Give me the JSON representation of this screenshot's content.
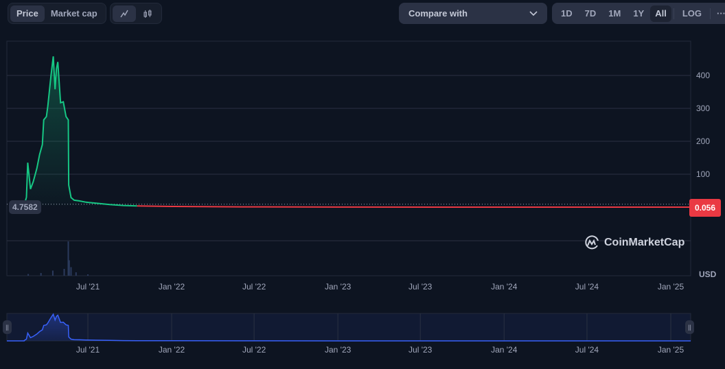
{
  "toolbar": {
    "metric_tabs": [
      {
        "label": "Price",
        "active": true
      },
      {
        "label": "Market cap",
        "active": false
      }
    ],
    "chart_types": [
      {
        "icon": "line-chart-icon",
        "active": true
      },
      {
        "icon": "candlestick-icon",
        "active": false
      }
    ],
    "compare_label": "Compare with",
    "ranges": [
      {
        "label": "1D"
      },
      {
        "label": "7D"
      },
      {
        "label": "1M"
      },
      {
        "label": "1Y"
      },
      {
        "label": "All",
        "active": true
      }
    ],
    "log_label": "LOG",
    "more_label": "···"
  },
  "current_label": "4.7582",
  "last_price_label": "0.056",
  "currency": "USD",
  "watermark": "CoinMarketCap",
  "colors": {
    "up": "#16c784",
    "down": "#ea3943",
    "navigator": "#3861fb"
  },
  "chart_data": {
    "type": "line",
    "title": "",
    "ylabel": "USD",
    "ylim": [
      0,
      500
    ],
    "yticks": [
      100,
      200,
      300,
      400
    ],
    "xticks": [
      {
        "date": "2021-07-01",
        "label": "Jul '21"
      },
      {
        "date": "2022-01-01",
        "label": "Jan '22"
      },
      {
        "date": "2022-07-01",
        "label": "Jul '22"
      },
      {
        "date": "2023-01-01",
        "label": "Jan '23"
      },
      {
        "date": "2023-07-01",
        "label": "Jul '23"
      },
      {
        "date": "2024-01-01",
        "label": "Jan '24"
      },
      {
        "date": "2024-07-01",
        "label": "Jul '24"
      },
      {
        "date": "2025-01-01",
        "label": "Jan '25"
      }
    ],
    "xrange": [
      "2021-01-31",
      "2025-02-05"
    ],
    "reference_value": 4.7582,
    "series": [
      {
        "name": "Price",
        "points": [
          [
            "2021-02-11",
            5
          ],
          [
            "2021-02-16",
            30
          ],
          [
            "2021-02-19",
            135
          ],
          [
            "2021-02-25",
            55
          ],
          [
            "2021-03-03",
            77
          ],
          [
            "2021-03-11",
            118
          ],
          [
            "2021-03-17",
            160
          ],
          [
            "2021-03-23",
            190
          ],
          [
            "2021-03-26",
            265
          ],
          [
            "2021-04-01",
            275
          ],
          [
            "2021-04-04",
            306
          ],
          [
            "2021-04-11",
            400
          ],
          [
            "2021-04-16",
            458
          ],
          [
            "2021-04-20",
            358
          ],
          [
            "2021-04-23",
            420
          ],
          [
            "2021-04-26",
            441
          ],
          [
            "2021-04-29",
            379
          ],
          [
            "2021-05-02",
            317
          ],
          [
            "2021-05-08",
            320
          ],
          [
            "2021-05-14",
            275
          ],
          [
            "2021-05-19",
            265
          ],
          [
            "2021-05-20",
            67
          ],
          [
            "2021-05-25",
            29
          ],
          [
            "2021-06-01",
            21
          ],
          [
            "2021-06-12",
            19
          ],
          [
            "2021-06-27",
            15
          ],
          [
            "2021-07-19",
            12
          ],
          [
            "2021-08-18",
            8
          ],
          [
            "2021-09-17",
            5
          ],
          [
            "2021-10-17",
            3.5
          ],
          [
            "2022-01-01",
            2
          ],
          [
            "2022-06-01",
            0.8
          ],
          [
            "2023-01-01",
            0.3
          ],
          [
            "2024-01-01",
            0.1
          ],
          [
            "2025-01-25",
            0.056
          ]
        ]
      }
    ],
    "volume": [
      [
        "2021-02-20",
        0.05
      ],
      [
        "2021-03-20",
        0.08
      ],
      [
        "2021-04-15",
        0.15
      ],
      [
        "2021-05-10",
        0.2
      ],
      [
        "2021-05-19",
        1.0
      ],
      [
        "2021-05-21",
        0.45
      ],
      [
        "2021-05-25",
        0.25
      ],
      [
        "2021-06-05",
        0.1
      ],
      [
        "2021-07-01",
        0.04
      ]
    ]
  }
}
